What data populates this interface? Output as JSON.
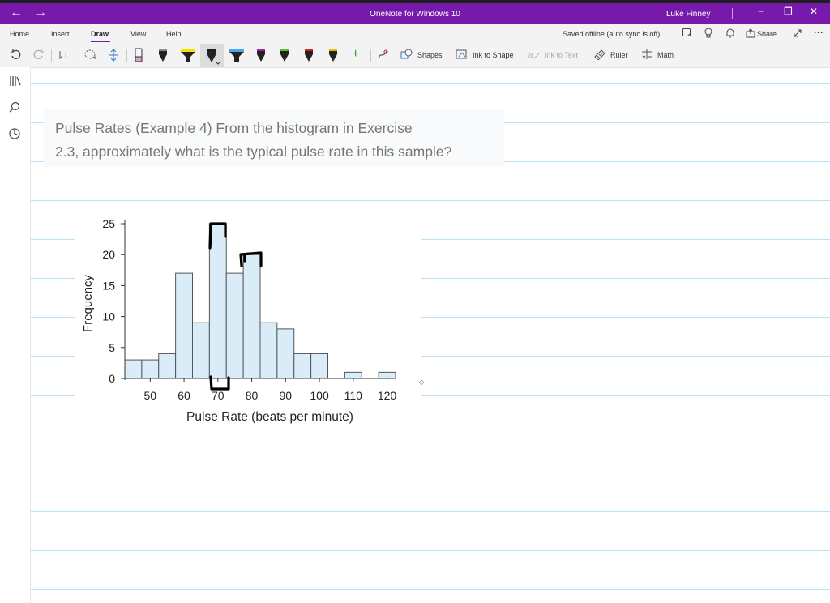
{
  "window": {
    "back": "←",
    "forward": "→",
    "title": "OneNote for Windows 10",
    "user": "Luke Finney",
    "minimize": "−",
    "restore": "❐",
    "close": "✕"
  },
  "menu": {
    "tabs": [
      "Home",
      "Insert",
      "Draw",
      "View",
      "Help"
    ],
    "active_tab": "Draw",
    "sync_status": "Saved offline (auto sync is off)",
    "share": "Share",
    "more": "···"
  },
  "toolbar": {
    "shapes": "Shapes",
    "ink_to_shape": "Ink to Shape",
    "ink_to_text": "Ink to Text",
    "ruler": "Ruler",
    "math": "Math",
    "pen_colors": [
      "#8a8a8a",
      "#e8c64a",
      "#f2e200",
      "#1b1b1b",
      "#4aa8e8",
      "#b01ea8",
      "#55c22b",
      "#d6221f",
      "#f2b600"
    ]
  },
  "note": {
    "question_line1": "Pulse Rates (Example 4) From the histogram in Exercise",
    "question_line2": "2.3, approximately what is the typical pulse rate in this sample?"
  },
  "chart_data": {
    "type": "bar",
    "bin_width": 5,
    "bin_starts": [
      42.5,
      47.5,
      52.5,
      57.5,
      62.5,
      67.5,
      72.5,
      77.5,
      82.5,
      87.5,
      92.5,
      97.5,
      102.5,
      107.5,
      112.5,
      117.5
    ],
    "values": [
      3,
      3,
      4,
      17,
      9,
      25,
      17,
      20,
      9,
      8,
      4,
      4,
      0,
      1,
      0,
      1
    ],
    "xticks": [
      "50",
      "60",
      "70",
      "80",
      "90",
      "100",
      "110",
      "120"
    ],
    "xtick_values": [
      50,
      60,
      70,
      80,
      90,
      100,
      110,
      120
    ],
    "yticks": [
      "0",
      "5",
      "10",
      "15",
      "20",
      "25"
    ],
    "ytick_values": [
      0,
      5,
      10,
      15,
      20,
      25
    ],
    "xlim": [
      42.5,
      122.5
    ],
    "ylim": [
      0,
      25
    ],
    "xlabel": "Pulse Rate (beats per minute)",
    "ylabel": "Frequency",
    "bar_color": "#d9ecf7",
    "edge_color": "#555555"
  },
  "colors": {
    "accent": "#7719aa",
    "rule": "#bfe0f5"
  }
}
